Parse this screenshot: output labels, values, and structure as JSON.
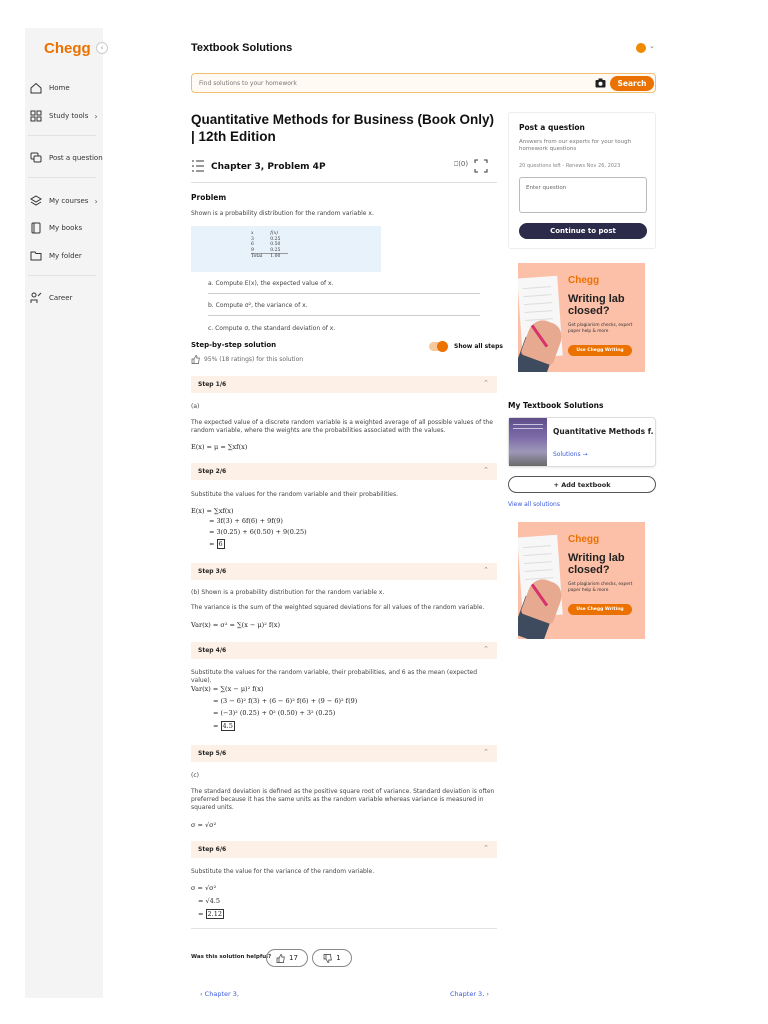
{
  "sidebar": {
    "logo": "Chegg",
    "collapse": "‹",
    "items": [
      {
        "label": "Home",
        "chevron": ""
      },
      {
        "label": "Study tools",
        "chevron": "›"
      },
      {
        "label": "Post a question",
        "chevron": ""
      },
      {
        "label": "My courses",
        "chevron": "›"
      },
      {
        "label": "My books",
        "chevron": ""
      },
      {
        "label": "My folder",
        "chevron": ""
      },
      {
        "label": "Career",
        "chevron": ""
      }
    ]
  },
  "header": {
    "title": "Textbook Solutions",
    "search_placeholder": "Find solutions to your homework",
    "search_button": "Search"
  },
  "book": {
    "title": "Quantitative Methods for Business (Book Only) | 12th Edition",
    "chapter": "Chapter 3, Problem 4P",
    "bookmark_count": "(0)"
  },
  "problem": {
    "heading": "Problem",
    "text": "Shown is a probability distribution for the random variable x.",
    "table": {
      "headers": [
        "x",
        "f(x)"
      ],
      "rows": [
        [
          "3",
          "0.25"
        ],
        [
          "6",
          "0.50"
        ],
        [
          "9",
          "0.25"
        ]
      ],
      "total_label": "Total",
      "total_value": "1.00"
    },
    "questions": [
      "a. Compute E(x), the expected value of x.",
      "b. Compute σ², the variance of x.",
      "c. Compute σ, the standard deviation of x."
    ]
  },
  "solution": {
    "heading": "Step-by-step solution",
    "show_all": "Show all steps",
    "rating": "95% (18 ratings) for this solution",
    "steps": [
      {
        "label": "Step 1/6"
      },
      {
        "label": "Step 2/6"
      },
      {
        "label": "Step 3/6"
      },
      {
        "label": "Step 4/6"
      },
      {
        "label": "Step 5/6"
      },
      {
        "label": "Step 6/6"
      }
    ],
    "s1_part": "(a)",
    "s1_text": "The expected value of a discrete random variable is a weighted average of all possible values of the random variable, where the weights are the probabilities associated with the values.",
    "s1_formula": "E(x) = μ = ∑xf(x)",
    "s2_text": "Substitute the values for the random variable and their probabilities.",
    "s2_lines": [
      "E(x) = ∑xf(x)",
      "= 3f(3) + 6f(6) + 9f(9)",
      "= 3(0.25) + 6(0.50) + 9(0.25)"
    ],
    "s2_result": "6",
    "s3_text1": "(b) Shown is a probability distribution for the random variable x.",
    "s3_text2": "The variance is the sum of the weighted squared deviations for all values of the random variable.",
    "s3_formula": "Var(x) = σ² = ∑(x − μ)² f(x)",
    "s4_text": "Substitute the values for the random variable, their probabilities, and 6 as the mean (expected value).",
    "s4_lines": [
      "Var(x) = ∑(x − μ)² f(x)",
      "= (3 − 6)² f(3) + (6 − 6)² f(6) + (9 − 6)² f(9)",
      "= (−3)² (0.25) + 0² (0.50) + 3² (0.25)"
    ],
    "s4_result": "4.5",
    "s5_part": "(c)",
    "s5_text": "The standard deviation is defined as the positive square root of variance. Standard deviation is often preferred because it has the same units as the random variable whereas variance is measured in squared units.",
    "s5_formula": "σ = √σ²",
    "s6_text": "Substitute the value for the variance of the random variable.",
    "s6_lines": [
      "σ = √σ²",
      "= √4.5"
    ],
    "s6_result": "2.12"
  },
  "feedback": {
    "question": "Was this solution helpful?",
    "likes": "17",
    "dislikes": "1"
  },
  "pager": {
    "prev": "Chapter 3,",
    "next": "Chapter 3,"
  },
  "post_question": {
    "heading": "Post a question",
    "sub": "Answers from our experts for your tough homework questions",
    "meta": "20 questions left - Renews Nov 26, 2023",
    "placeholder": "Enter question",
    "button": "Continue to post"
  },
  "ad": {
    "brand": "Chegg",
    "headline": "Writing lab closed?",
    "sub": "Get plagiarism checks, expert paper help & more",
    "button": "Use Chegg Writing"
  },
  "my_textbooks": {
    "heading": "My Textbook Solutions",
    "book_name": "Quantitative Methods f...",
    "solutions_link": "Solutions →",
    "add_button": "+ Add textbook",
    "view_all": "View all solutions"
  },
  "colors": {
    "brand_orange": "#eb7100",
    "step_header_bg": "#fdf0e6",
    "post_button": "#2d2b4a",
    "link_blue": "#3b5bdb"
  }
}
